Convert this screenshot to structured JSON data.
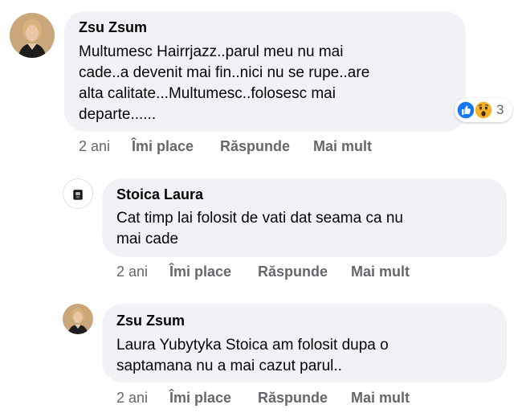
{
  "comments": [
    {
      "author": "Zsu Zsum",
      "lines": [
        "Multumesc Hairrjazz..parul meu nu mai",
        "cade..a devenit mai fin..nici nu se rupe..are",
        "alta calitate...Multumesc..folosesc mai",
        "departe......"
      ],
      "time": "2 ani",
      "like": "Îmi place",
      "reply": "Răspunde",
      "more": "Mai mult",
      "reactions": {
        "icons": [
          "like-icon",
          "wow-icon"
        ],
        "count": "3"
      }
    },
    {
      "author": "Stoica Laura",
      "lines": [
        "Cat timp lai folosit de vati dat seama ca nu",
        "mai cade"
      ],
      "time": "2 ani",
      "like": "Îmi place",
      "reply": "Răspunde",
      "more": "Mai mult"
    },
    {
      "author": "Zsu Zsum",
      "lines": [
        "Laura Yubytyka Stoica am folosit dupa o",
        "saptamana nu a mai cazut parul.."
      ],
      "time": "2 ani",
      "like": "Îmi place",
      "reply": "Răspunde",
      "more": "Mai mult"
    }
  ],
  "colors": {
    "bubble": "#f0f2f5",
    "meta": "#65676b",
    "text": "#050505",
    "like_blue": "#1877f2",
    "wow_yellow": "#f7b125"
  }
}
